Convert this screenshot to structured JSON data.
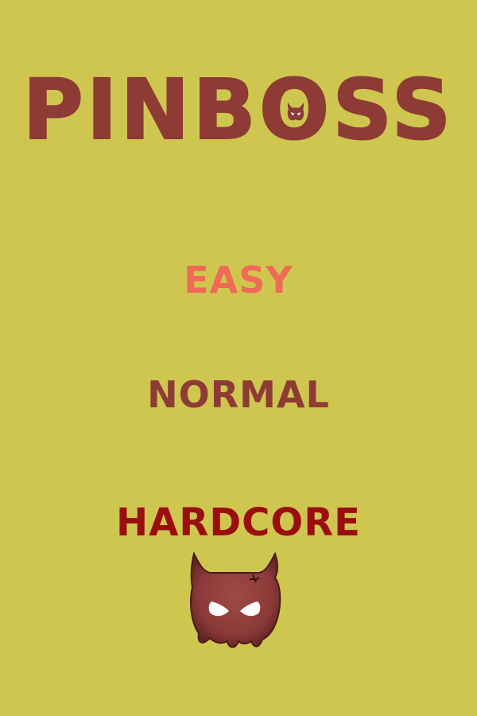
{
  "title": {
    "text_before": "PINB",
    "text_o": "O",
    "text_after": "SS"
  },
  "menu": {
    "easy": {
      "label": "EASY",
      "color": "#ef6a57"
    },
    "normal": {
      "label": "NORMAL",
      "color": "#8d3b34"
    },
    "hardcore": {
      "label": "HARDCORE",
      "color": "#9b0e0e"
    }
  },
  "colors": {
    "background": "#cfc650",
    "title": "#8d3b34",
    "devil_body": "#8a3a38"
  },
  "icons": {
    "title_mascot": "devil-face-icon",
    "hardcore_mascot": "devil-face-icon"
  }
}
